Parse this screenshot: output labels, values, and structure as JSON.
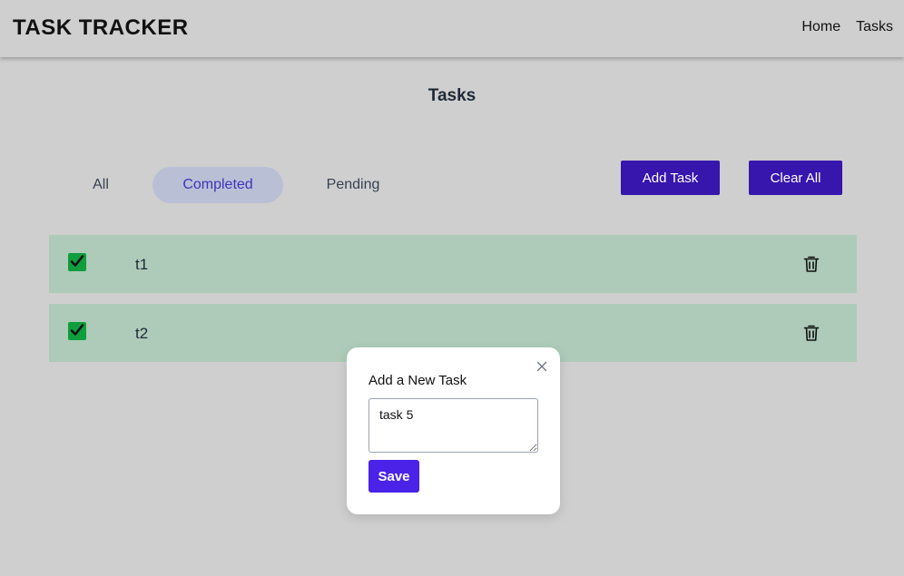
{
  "header": {
    "brand": "TASK TRACKER",
    "nav": [
      {
        "label": "Home"
      },
      {
        "label": "Tasks"
      }
    ]
  },
  "page": {
    "title": "Tasks"
  },
  "filters": {
    "all": "All",
    "completed": "Completed",
    "pending": "Pending",
    "active": "Completed"
  },
  "actions": {
    "add_task": "Add Task",
    "clear_all": "Clear All"
  },
  "tasks": [
    {
      "text": "t1",
      "completed": true
    },
    {
      "text": "t2",
      "completed": true
    }
  ],
  "modal": {
    "title": "Add a New Task",
    "input_value": "task 5",
    "save_label": "Save"
  },
  "colors": {
    "background": "#cfcfcf",
    "primary_button": "#3616ad",
    "save_button": "#4a22e8",
    "completed_row": "#adcbb8",
    "checkbox": "#0f9d3e",
    "active_filter_bg": "#b9c0d6",
    "active_filter_text": "#3f34b8"
  },
  "icons": {
    "checkbox": "check-icon",
    "delete": "trash-icon",
    "close": "close-icon"
  }
}
